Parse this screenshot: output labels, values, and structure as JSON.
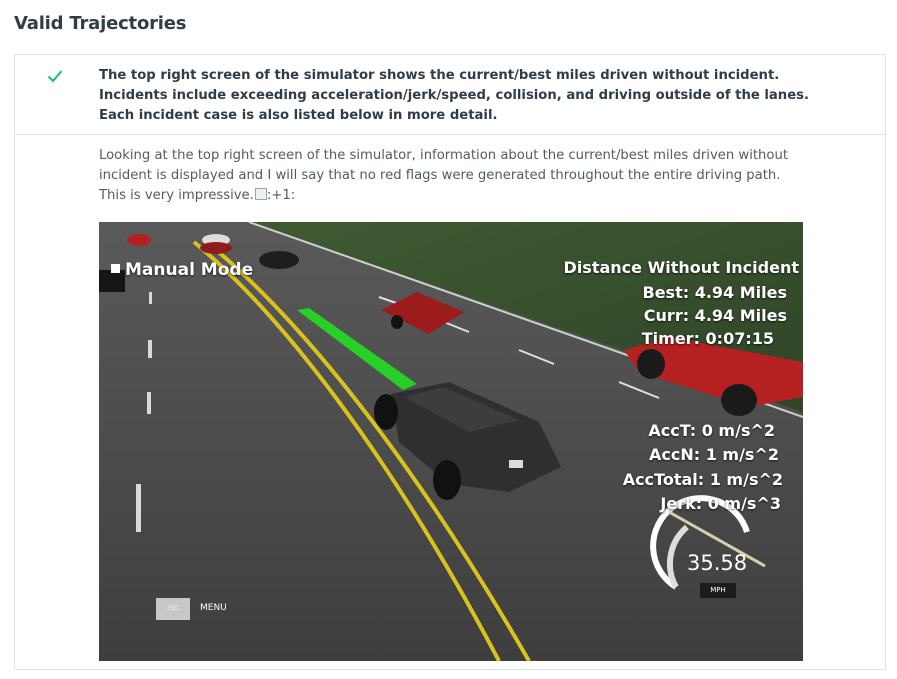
{
  "section": {
    "title": "Valid Trajectories"
  },
  "rubric": {
    "status_icon": "check-icon",
    "status_color": "#02b3e4",
    "check_color": "#15c26b",
    "requirement": "The top right screen of the simulator shows the current/best miles driven without incident. Incidents include exceeding acceleration/jerk/speed, collision, and driving outside of the lanes. Each incident case is also listed below in more detail.",
    "review": "Looking at the top right screen of the simulator, information about the current/best miles driven without incident is displayed and I will say that no red flags were generated throughout the entire driving path. This is very impressive.",
    "broken_image_alt": ":+1:"
  },
  "simulator": {
    "mode_label": "Manual Mode",
    "distance_title": "Distance Without Incident",
    "best": "Best: 4.94 Miles",
    "curr": "Curr: 4.94 Miles",
    "timer": "Timer: 0:07:15",
    "acc_t": "AccT: 0 m/s^2",
    "acc_n": "AccN: 1 m/s^2",
    "acc_total": "AccTotal: 1 m/s^2",
    "jerk": "Jerk: 0 m/s^3",
    "speed": "35.58",
    "speed_unit": "MPH",
    "esc_key": "ESC",
    "menu_label": "MENU"
  }
}
